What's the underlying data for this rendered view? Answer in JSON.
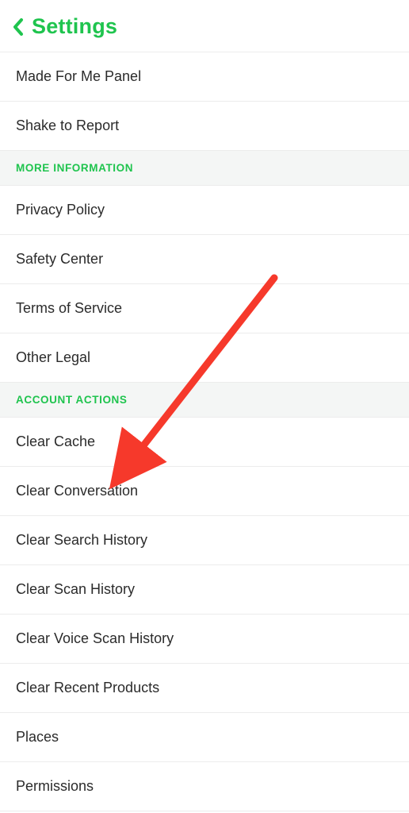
{
  "header": {
    "title": "Settings"
  },
  "groups": [
    {
      "header": null,
      "items": [
        {
          "id": "made-for-me-panel",
          "label": "Made For Me Panel"
        },
        {
          "id": "shake-to-report",
          "label": "Shake to Report"
        }
      ]
    },
    {
      "header": "MORE INFORMATION",
      "items": [
        {
          "id": "privacy-policy",
          "label": "Privacy Policy"
        },
        {
          "id": "safety-center",
          "label": "Safety Center"
        },
        {
          "id": "terms-of-service",
          "label": "Terms of Service"
        },
        {
          "id": "other-legal",
          "label": "Other Legal"
        }
      ]
    },
    {
      "header": "ACCOUNT ACTIONS",
      "items": [
        {
          "id": "clear-cache",
          "label": "Clear Cache"
        },
        {
          "id": "clear-conversation",
          "label": "Clear Conversation"
        },
        {
          "id": "clear-search-history",
          "label": "Clear Search History"
        },
        {
          "id": "clear-scan-history",
          "label": "Clear Scan History"
        },
        {
          "id": "clear-voice-scan-history",
          "label": "Clear Voice Scan History"
        },
        {
          "id": "clear-recent-products",
          "label": "Clear Recent Products"
        },
        {
          "id": "places",
          "label": "Places"
        },
        {
          "id": "permissions",
          "label": "Permissions"
        }
      ]
    }
  ],
  "annotation": {
    "arrow_color": "#f6392b"
  }
}
